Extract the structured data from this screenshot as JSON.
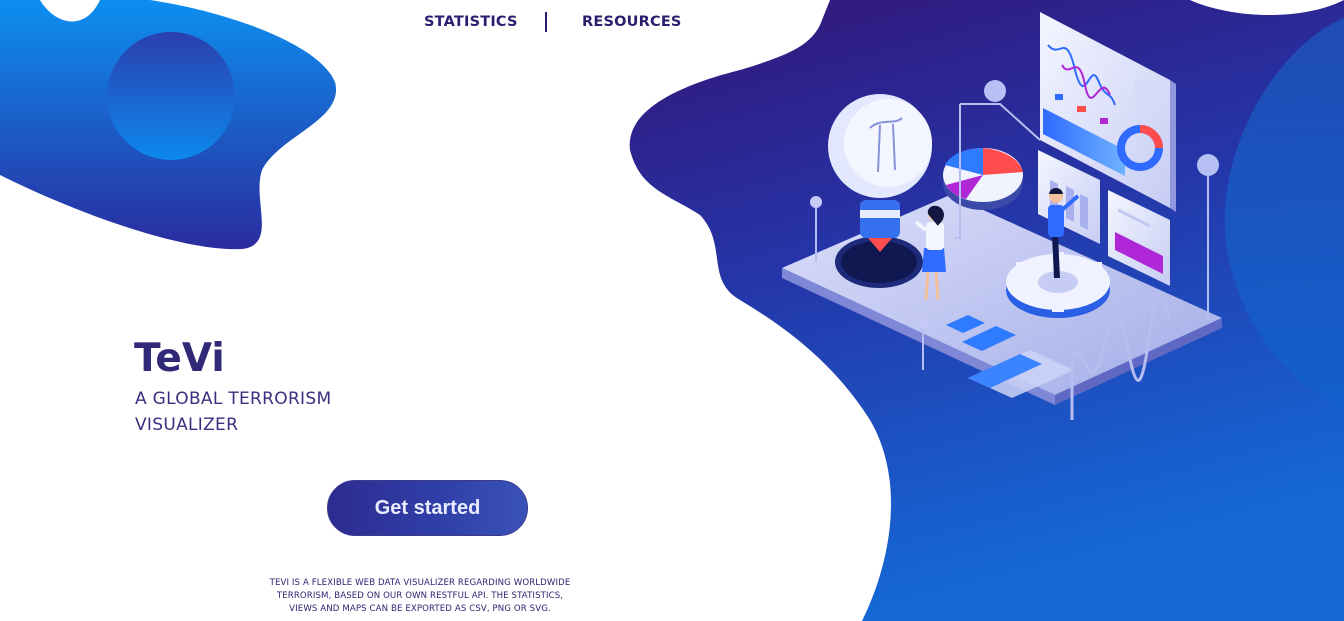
{
  "nav": {
    "items": [
      {
        "label": "STATISTICS"
      },
      {
        "label": "RESOURCES"
      }
    ]
  },
  "hero": {
    "title": "TeVi",
    "subtitle_line1": "A GLOBAL TERRORISM",
    "subtitle_line2": "VISUALIZER",
    "cta_label": "Get started",
    "description_line1": "TEVI IS A FLEXIBLE WEB DATA VISUALIZER REGARDING WORLDWIDE",
    "description_line2": "TERRORISM, BASED ON OUR OWN RESTFUL API. THE STATISTICS,",
    "description_line3": "VIEWS AND MAPS CAN BE EXPORTED AS CSV, PNG OR SVG."
  },
  "colors": {
    "brand_dark": "#2a1f6e",
    "blob_top": "#0d8ff0",
    "blob_bottom": "#2a2c9e",
    "right_blob_top": "#341477",
    "right_blob_bottom": "#1568d6"
  }
}
